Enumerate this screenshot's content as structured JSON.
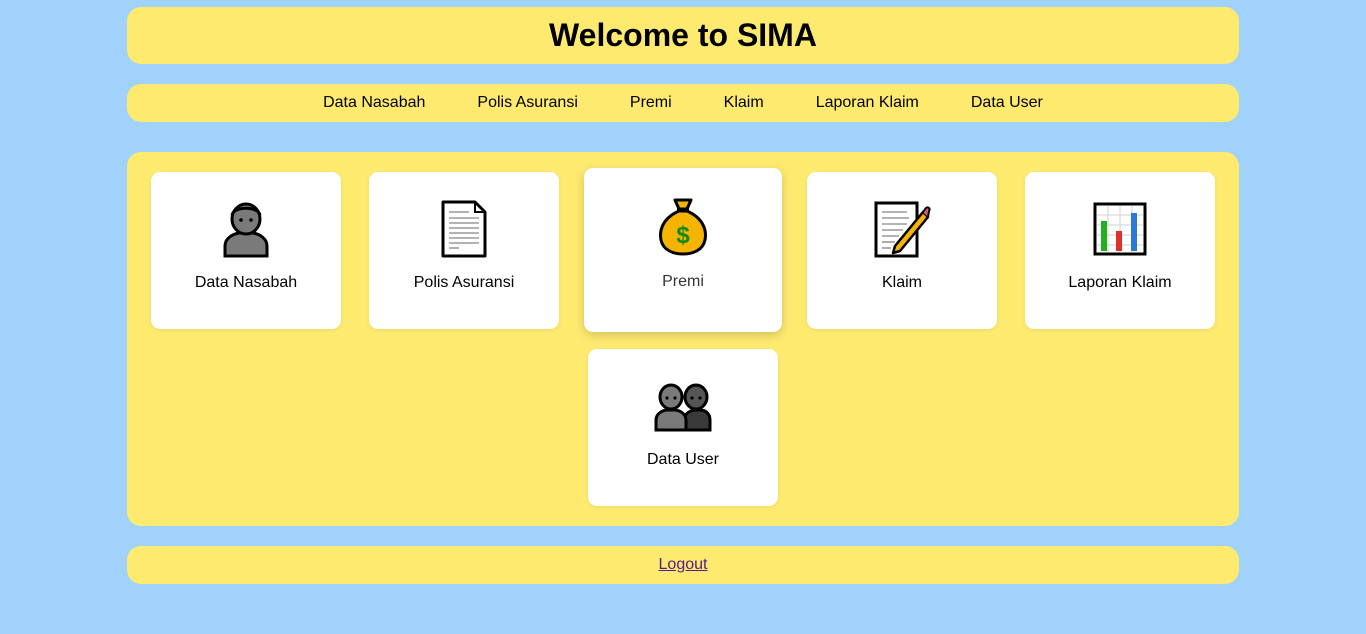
{
  "header": {
    "title": "Welcome to SIMA"
  },
  "nav": {
    "items": [
      {
        "label": "Data Nasabah"
      },
      {
        "label": "Polis Asuransi"
      },
      {
        "label": "Premi"
      },
      {
        "label": "Klaim"
      },
      {
        "label": "Laporan Klaim"
      },
      {
        "label": "Data User"
      }
    ]
  },
  "cards": [
    {
      "label": "Data Nasabah",
      "icon": "person-icon"
    },
    {
      "label": "Polis Asuransi",
      "icon": "document-icon"
    },
    {
      "label": "Premi",
      "icon": "money-bag-icon"
    },
    {
      "label": "Klaim",
      "icon": "memo-icon"
    },
    {
      "label": "Laporan Klaim",
      "icon": "bar-chart-icon"
    },
    {
      "label": "Data User",
      "icon": "users-icon"
    }
  ],
  "footer": {
    "logout_label": "Logout"
  },
  "colors": {
    "background": "#a0d2fc",
    "panel": "#ffea70",
    "card": "#ffffff",
    "link_visited": "#551a8b"
  }
}
